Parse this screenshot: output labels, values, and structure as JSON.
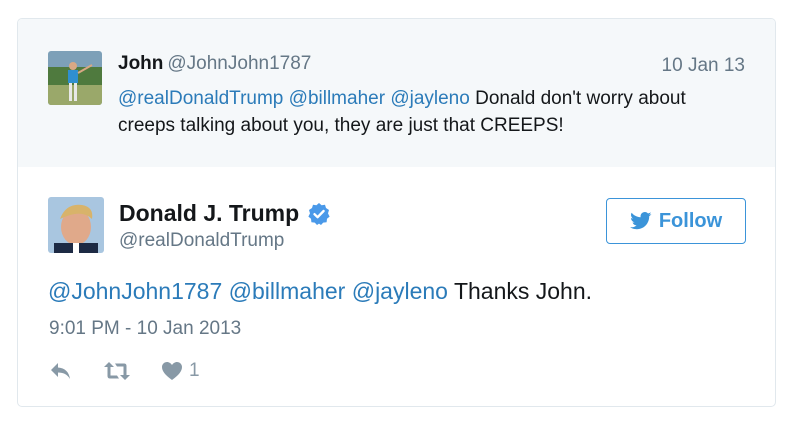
{
  "quoted_tweet": {
    "author_name": "John",
    "author_handle": "@JohnJohn1787",
    "date": "10 Jan 13",
    "mentions": [
      "@realDonaldTrump",
      "@billmaher",
      "@jayleno"
    ],
    "text": "Donald don't worry about creeps talking about you, they are just that CREEPS!"
  },
  "tweet": {
    "author_name": "Donald J. Trump",
    "author_handle": "@realDonaldTrump",
    "verified": true,
    "follow_label": "Follow",
    "mentions": [
      "@JohnJohn1787",
      "@billmaher",
      "@jayleno"
    ],
    "text": "Thanks John.",
    "timestamp": "9:01 PM - 10 Jan 2013",
    "like_count": "1"
  },
  "colors": {
    "link": "#2b7bb9",
    "follow_blue": "#3b94d9",
    "muted": "#657786",
    "quote_bg": "#f5f8fa"
  },
  "icons": [
    "reply-icon",
    "retweet-icon",
    "heart-icon",
    "twitter-bird-icon",
    "verified-badge-icon"
  ]
}
